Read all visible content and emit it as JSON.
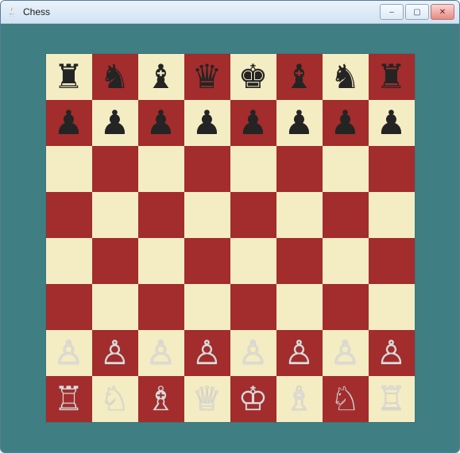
{
  "window": {
    "title": "Chess",
    "icon_name": "java-icon"
  },
  "controls": {
    "minimize_label": "–",
    "maximize_label": "▢",
    "close_label": "✕"
  },
  "board": {
    "light_color": "#f4edc3",
    "dark_color": "#a32c2c",
    "background_color": "#3f7f84",
    "rows": [
      [
        "br",
        "bn",
        "bb",
        "bq",
        "bk",
        "bb",
        "bn",
        "br"
      ],
      [
        "bp",
        "bp",
        "bp",
        "bp",
        "bp",
        "bp",
        "bp",
        "bp"
      ],
      [
        "",
        "",
        "",
        "",
        "",
        "",
        "",
        ""
      ],
      [
        "",
        "",
        "",
        "",
        "",
        "",
        "",
        ""
      ],
      [
        "",
        "",
        "",
        "",
        "",
        "",
        "",
        ""
      ],
      [
        "",
        "",
        "",
        "",
        "",
        "",
        "",
        ""
      ],
      [
        "wp",
        "wp",
        "wp",
        "wp",
        "wp",
        "wp",
        "wp",
        "wp"
      ],
      [
        "wr",
        "wn",
        "wb",
        "wq",
        "wk",
        "wb",
        "wn",
        "wr"
      ]
    ]
  },
  "piece_glyphs": {
    "wk": "♔",
    "wq": "♕",
    "wr": "♖",
    "wb": "♗",
    "wn": "♘",
    "wp": "♙",
    "bk": "♚",
    "bq": "♛",
    "br": "♜",
    "bb": "♝",
    "bn": "♞",
    "bp": "♟"
  },
  "piece_names": {
    "wk": "white-king",
    "wq": "white-queen",
    "wr": "white-rook",
    "wb": "white-bishop",
    "wn": "white-knight",
    "wp": "white-pawn",
    "bk": "black-king",
    "bq": "black-queen",
    "br": "black-rook",
    "bb": "black-bishop",
    "bn": "black-knight",
    "bp": "black-pawn"
  }
}
